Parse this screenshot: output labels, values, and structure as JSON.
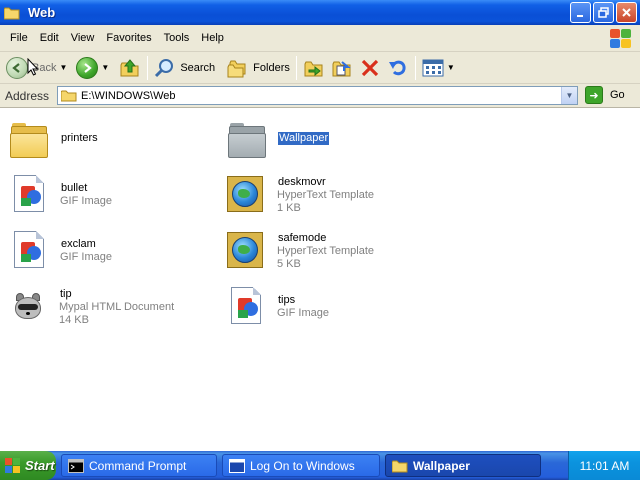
{
  "window": {
    "title": "Web",
    "controls": [
      "minimize",
      "restore",
      "close"
    ]
  },
  "menubar": {
    "items": [
      "File",
      "Edit",
      "View",
      "Favorites",
      "Tools",
      "Help"
    ]
  },
  "toolbar": {
    "back_label": "Back",
    "search_label": "Search",
    "folders_label": "Folders"
  },
  "addressbar": {
    "label": "Address",
    "value": "E:\\WINDOWS\\Web",
    "go_label": "Go"
  },
  "files": [
    {
      "name": "printers",
      "type": "",
      "size": "",
      "icon": "folder-icon"
    },
    {
      "name": "Wallpaper",
      "type": "",
      "size": "",
      "icon": "folder-icon",
      "selected": true
    },
    {
      "name": "bullet",
      "type": "GIF Image",
      "size": "",
      "icon": "gif-image-icon"
    },
    {
      "name": "deskmovr",
      "type": "HyperText Template",
      "size": "1 KB",
      "icon": "hypertext-template-icon"
    },
    {
      "name": "exclam",
      "type": "GIF Image",
      "size": "",
      "icon": "gif-image-icon"
    },
    {
      "name": "safemode",
      "type": "HyperText Template",
      "size": "5 KB",
      "icon": "hypertext-template-icon"
    },
    {
      "name": "tip",
      "type": "Mypal HTML Document",
      "size": "14 KB",
      "icon": "mypal-html-icon"
    },
    {
      "name": "tips",
      "type": "GIF Image",
      "size": "",
      "icon": "gif-image-icon"
    }
  ],
  "taskbar": {
    "start_label": "Start",
    "tasks": [
      "Command Prompt",
      "Log On to Windows",
      "Wallpaper"
    ],
    "clock": "11:01 AM"
  },
  "colors": {
    "titlebar": "#0a4fd6",
    "selection": "#316ac5",
    "chrome": "#ece9d8",
    "taskbar": "#245edb",
    "start_button": "#3a9b2a"
  }
}
